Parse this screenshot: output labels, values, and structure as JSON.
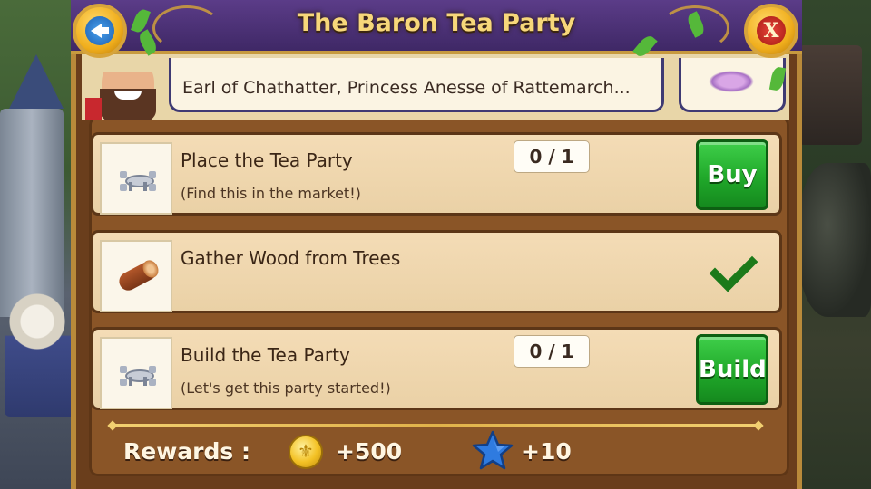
{
  "title": "The Baron Tea Party",
  "description": "Earl of Chathatter, Princess Anesse of Rattemarch...",
  "tasks": [
    {
      "title": "Place the Tea Party",
      "subtitle": "(Find this in the market!)",
      "progress": "0 / 1",
      "action": "Buy",
      "icon": "tea-table-icon",
      "completed": false
    },
    {
      "title": "Gather Wood from Trees",
      "subtitle": "",
      "progress": "",
      "action": "",
      "icon": "wood-log-icon",
      "completed": true
    },
    {
      "title": "Build the Tea Party",
      "subtitle": "(Let's get this party started!)",
      "progress": "0 / 1",
      "action": "Build",
      "icon": "tea-table-icon",
      "completed": false
    }
  ],
  "rewards": {
    "label": "Rewards :",
    "coins": "+500",
    "stars": "+10"
  },
  "colors": {
    "title_text": "#f7d77a",
    "title_bar": "#4a2f75",
    "button_green": "#20a82a",
    "check_green": "#1c7a1a",
    "panel_brown": "#8a5527"
  },
  "icons": {
    "back": "back-arrow-icon",
    "close": "close-x-icon",
    "coin": "coin-icon",
    "star": "star-icon",
    "check": "checkmark-icon"
  }
}
